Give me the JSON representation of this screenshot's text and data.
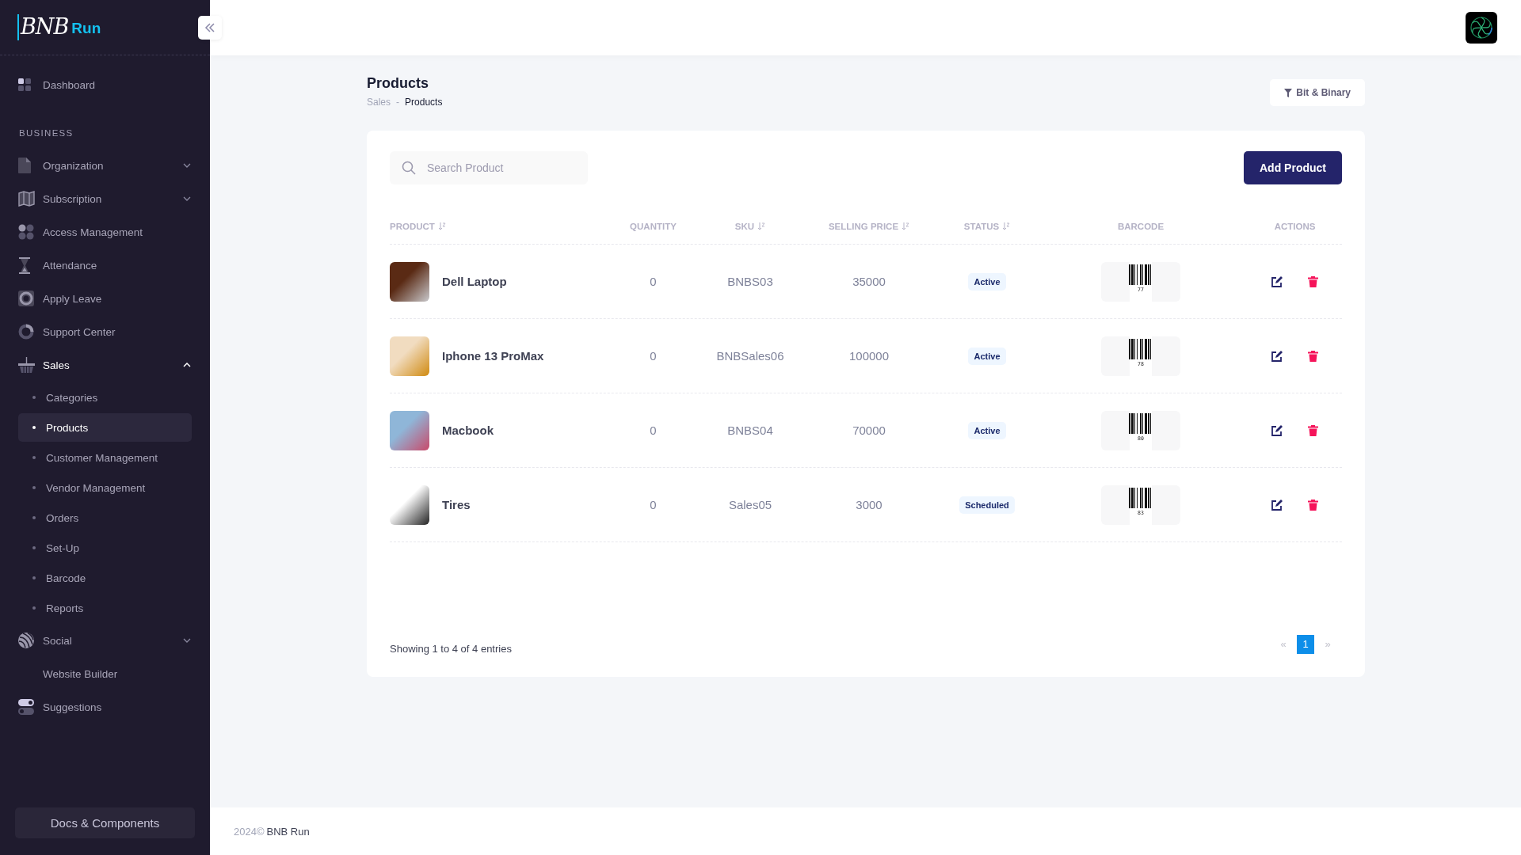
{
  "sidebar": {
    "logo": {
      "mark": "BNB",
      "name": "Run"
    },
    "items": [
      {
        "kind": "link",
        "label": "Dashboard"
      },
      {
        "kind": "heading",
        "label": "BUSINESS"
      },
      {
        "kind": "group",
        "label": "Organization",
        "expanded": false
      },
      {
        "kind": "group",
        "label": "Subscription",
        "expanded": false
      },
      {
        "kind": "link",
        "label": "Access Management"
      },
      {
        "kind": "link",
        "label": "Attendance"
      },
      {
        "kind": "link",
        "label": "Apply Leave"
      },
      {
        "kind": "link",
        "label": "Support Center"
      },
      {
        "kind": "group",
        "label": "Sales",
        "expanded": true,
        "children": [
          {
            "label": "Categories",
            "selected": false
          },
          {
            "label": "Products",
            "selected": true
          },
          {
            "label": "Customer Management",
            "selected": false
          },
          {
            "label": "Vendor Management",
            "selected": false
          },
          {
            "label": "Orders",
            "selected": false
          },
          {
            "label": "Set-Up",
            "selected": false
          },
          {
            "label": "Barcode",
            "selected": false
          },
          {
            "label": "Reports",
            "selected": false
          }
        ]
      },
      {
        "kind": "group",
        "label": "Social",
        "expanded": false
      },
      {
        "kind": "link",
        "label": "Website Builder"
      },
      {
        "kind": "link",
        "label": "Suggestions"
      }
    ],
    "docs_button": "Docs & Components"
  },
  "page": {
    "title": "Products",
    "breadcrumb": [
      "Sales",
      "Products"
    ],
    "breadcrumb_separator": "-",
    "filter_button": "Bit & Binary"
  },
  "toolbar": {
    "search": {
      "placeholder": "Search Product"
    },
    "add_button": "Add Product"
  },
  "table": {
    "columns": [
      {
        "label": "PRODUCT",
        "sortable": true
      },
      {
        "label": "QUANTITY",
        "sortable": false
      },
      {
        "label": "SKU",
        "sortable": true
      },
      {
        "label": "SELLING PRICE",
        "sortable": true
      },
      {
        "label": "STATUS",
        "sortable": true
      },
      {
        "label": "BARCODE",
        "sortable": false
      },
      {
        "label": "ACTIONS",
        "sortable": false
      }
    ],
    "rows": [
      {
        "product": "Dell Laptop",
        "quantity": "0",
        "sku": "BNBS03",
        "price": "35000",
        "status": "Active",
        "barcode": "77"
      },
      {
        "product": "Iphone 13 ProMax",
        "quantity": "0",
        "sku": "BNBSales06",
        "price": "100000",
        "status": "Active",
        "barcode": "78"
      },
      {
        "product": "Macbook",
        "quantity": "0",
        "sku": "BNBS04",
        "price": "70000",
        "status": "Active",
        "barcode": "80"
      },
      {
        "product": "Tires",
        "quantity": "0",
        "sku": "Sales05",
        "price": "3000",
        "status": "Scheduled",
        "barcode": "83"
      }
    ]
  },
  "pagination": {
    "summary": "Showing 1 to 4 of 4 entries",
    "prev": "«",
    "pages": [
      {
        "label": "1",
        "selected": true
      }
    ],
    "next": "»"
  },
  "footer": {
    "year": "2024©",
    "brand": "BNB Run"
  }
}
